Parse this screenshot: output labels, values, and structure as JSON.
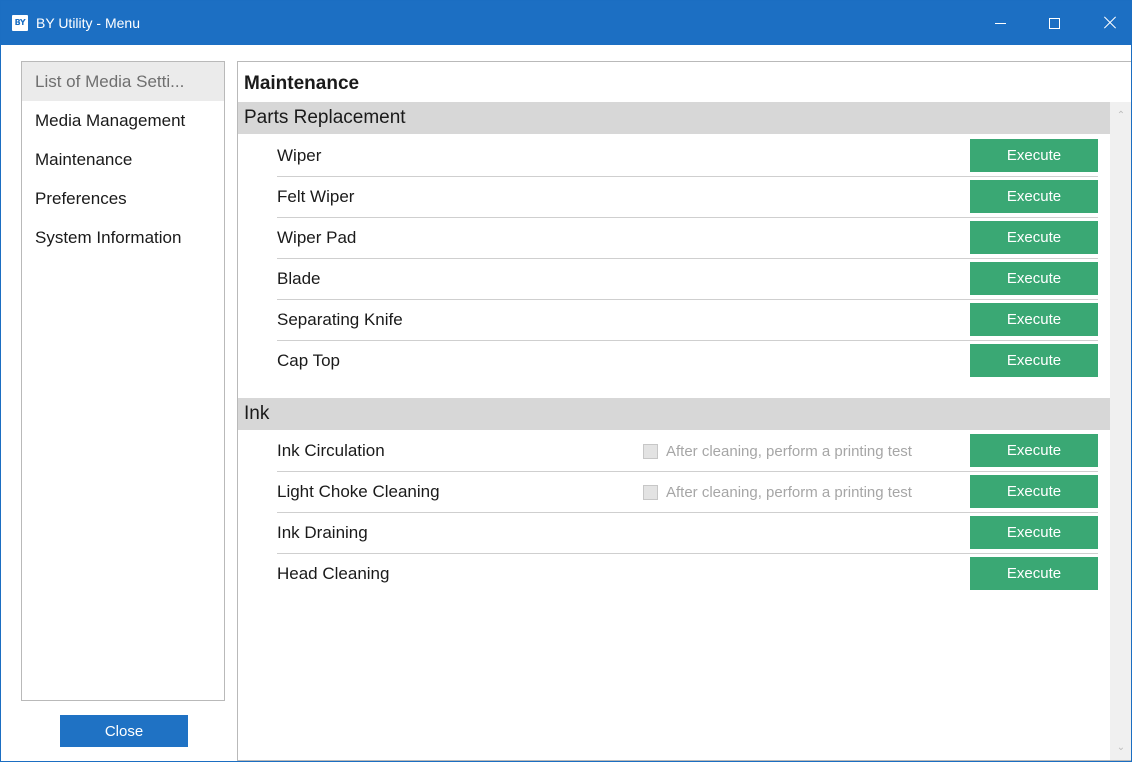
{
  "window": {
    "app_icon_text": "BY",
    "title": "BY Utility - Menu"
  },
  "sidebar": {
    "items": [
      {
        "label": "List of Media Setti...",
        "selected": true
      },
      {
        "label": "Media Management",
        "selected": false
      },
      {
        "label": "Maintenance",
        "selected": false
      },
      {
        "label": "Preferences",
        "selected": false
      },
      {
        "label": "System Information",
        "selected": false
      }
    ],
    "close_label": "Close"
  },
  "main": {
    "title": "Maintenance",
    "sections": [
      {
        "header": "Parts Replacement",
        "rows": [
          {
            "label": "Wiper",
            "button": "Execute"
          },
          {
            "label": "Felt Wiper",
            "button": "Execute"
          },
          {
            "label": "Wiper Pad",
            "button": "Execute"
          },
          {
            "label": "Blade",
            "button": "Execute"
          },
          {
            "label": "Separating Knife",
            "button": "Execute"
          },
          {
            "label": "Cap Top",
            "button": "Execute"
          }
        ]
      },
      {
        "header": "Ink",
        "rows": [
          {
            "label": "Ink Circulation",
            "button": "Execute",
            "checkbox_label": "After cleaning, perform a printing test",
            "checked": false
          },
          {
            "label": "Light Choke Cleaning",
            "button": "Execute",
            "checkbox_label": "After cleaning, perform a printing test",
            "checked": false
          },
          {
            "label": "Ink Draining",
            "button": "Execute"
          },
          {
            "label": "Head Cleaning",
            "button": "Execute"
          }
        ]
      }
    ]
  },
  "colors": {
    "titlebar": "#1c6fc3",
    "execute_button": "#3aa874",
    "close_button": "#1f72c4",
    "section_header": "#d7d7d7"
  },
  "icons": {
    "minimize": "minimize-icon",
    "maximize": "maximize-icon",
    "close": "close-icon",
    "scroll_up": "chevron-up-icon",
    "scroll_down": "chevron-down-icon"
  }
}
